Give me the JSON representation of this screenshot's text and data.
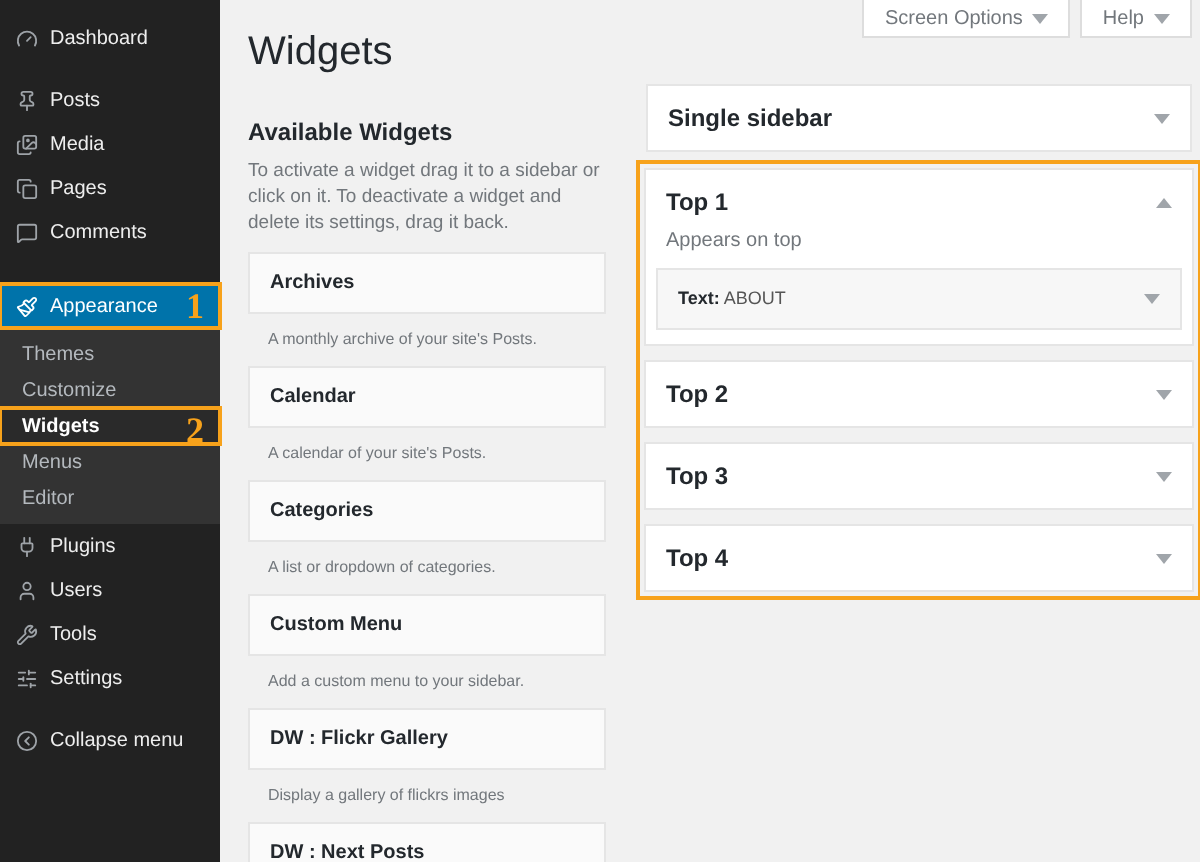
{
  "menu": {
    "groups": [
      [
        {
          "label": "Dashboard",
          "selected": false
        }
      ],
      [
        {
          "label": "Posts",
          "selected": false
        },
        {
          "label": "Media",
          "selected": false
        },
        {
          "label": "Pages",
          "selected": false
        },
        {
          "label": "Comments",
          "selected": false
        }
      ],
      [
        {
          "label": "Appearance",
          "selected": true,
          "callout": "1",
          "children": [
            {
              "label": "Themes",
              "selected": false
            },
            {
              "label": "Customize",
              "selected": false
            },
            {
              "label": "Widgets",
              "selected": true,
              "callout": "2"
            },
            {
              "label": "Menus",
              "selected": false
            },
            {
              "label": "Editor",
              "selected": false
            }
          ]
        },
        {
          "label": "Plugins",
          "selected": false
        },
        {
          "label": "Users",
          "selected": false
        },
        {
          "label": "Tools",
          "selected": false
        },
        {
          "label": "Settings",
          "selected": false
        }
      ],
      [
        {
          "label": "Collapse menu",
          "selected": false
        }
      ]
    ]
  },
  "header": {
    "title": "Widgets",
    "buttons": [
      "Screen Options",
      "Help"
    ]
  },
  "available": {
    "title": "Available Widgets",
    "description": "To activate a widget drag it to a sidebar or click on it. To deactivate a widget and delete its settings, drag it back.",
    "widgets": [
      {
        "name": "Archives",
        "description": "A monthly archive of your site's Posts."
      },
      {
        "name": "Calendar",
        "description": "A calendar of your site's Posts."
      },
      {
        "name": "Categories",
        "description": "A list or dropdown of categories."
      },
      {
        "name": "Custom Menu",
        "description": "Add a custom menu to your sidebar."
      },
      {
        "name": "DW : Flickr Gallery",
        "description": "Display a gallery of flickrs images"
      },
      {
        "name": "DW : Next Posts"
      }
    ]
  },
  "sidebars": [
    {
      "title": "Single sidebar",
      "expanded": false,
      "highlighted": false
    },
    {
      "title": "Top 1",
      "expanded": true,
      "highlighted": true,
      "description": "Appears on top",
      "widgets": [
        "**Text:** ABOUT"
      ]
    },
    {
      "title": "Top 2",
      "expanded": false,
      "highlighted": true
    },
    {
      "title": "Top 3",
      "expanded": false,
      "highlighted": true
    },
    {
      "title": "Top 4",
      "expanded": false,
      "highlighted": true
    }
  ]
}
